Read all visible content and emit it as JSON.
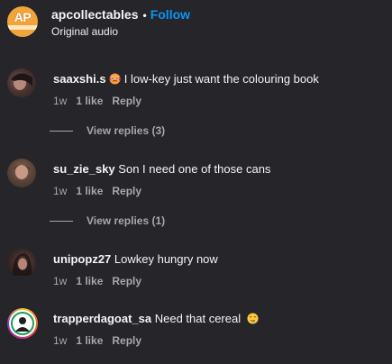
{
  "header": {
    "avatar_text": "AP",
    "username": "apcollectables",
    "separator": "•",
    "follow_label": "Follow",
    "audio_label": "Original audio"
  },
  "colors": {
    "accent": "#0a95f6",
    "background": "#25252a",
    "muted": "#a8a8a8"
  },
  "comments": [
    {
      "username": "saaxshi.s",
      "text": "I low-key just want the colouring book",
      "emoji": "face-holding-back-tears",
      "age": "1w",
      "likes": "1 like",
      "reply_label": "Reply",
      "replies_label": "View replies (3)"
    },
    {
      "username": "su_zie_sky",
      "text": "Son I need one of those cans",
      "age": "1w",
      "likes": "1 like",
      "reply_label": "Reply",
      "replies_label": "View replies (1)"
    },
    {
      "username": "unipopz27",
      "text": "Lowkey hungry now",
      "age": "1w",
      "likes": "1 like",
      "reply_label": "Reply"
    },
    {
      "username": "trapperdagoat_sa",
      "text": "Need that cereal",
      "emoji": "drooling-face",
      "age": "1w",
      "likes": "1 like",
      "reply_label": "Reply"
    }
  ]
}
